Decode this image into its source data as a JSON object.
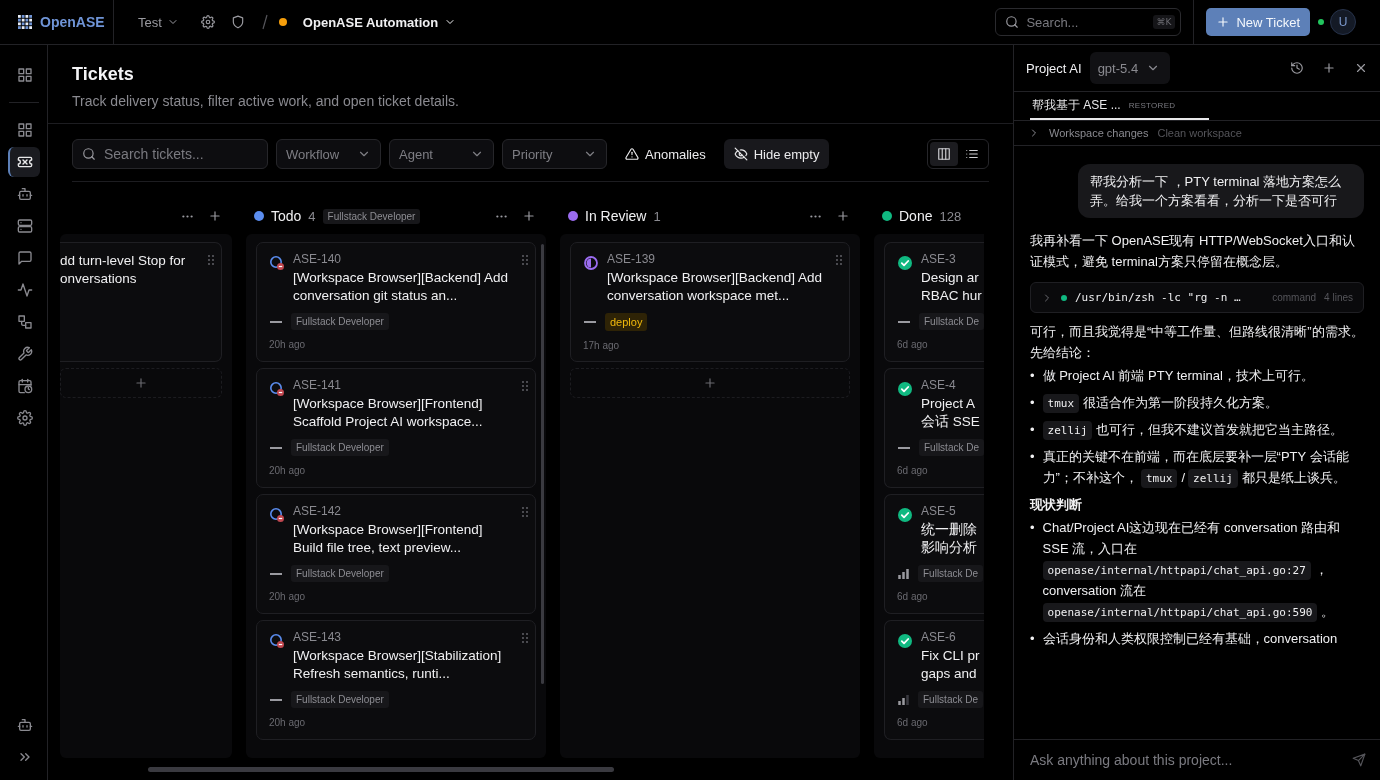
{
  "topbar": {
    "brand": "OpenASE",
    "org": "Test",
    "status_dot": {
      "color": "#f59e0b"
    },
    "project": "OpenASE Automation",
    "search": {
      "placeholder": "Search...",
      "shortcut": "⌘K"
    },
    "new_ticket": "New Ticket",
    "online": true,
    "avatar": "U"
  },
  "sidebar": {
    "home": {
      "kind": "dashboard",
      "selected": false
    },
    "items": [
      {
        "kind": "dashboard",
        "selected": false
      },
      {
        "kind": "ticket",
        "selected": true
      },
      {
        "kind": "bot",
        "selected": false
      },
      {
        "kind": "server",
        "selected": false
      },
      {
        "kind": "chat",
        "selected": false
      },
      {
        "kind": "activity",
        "selected": false
      },
      {
        "kind": "workflow",
        "selected": false
      },
      {
        "kind": "wrench",
        "selected": false
      },
      {
        "kind": "calendar",
        "selected": false
      },
      {
        "kind": "settings",
        "selected": false
      }
    ],
    "bottom": [
      {
        "kind": "bot",
        "selected": false
      },
      {
        "kind": "expand",
        "selected": false
      }
    ]
  },
  "page": {
    "title": "Tickets",
    "subtitle": "Track delivery status, filter active work, and open ticket details."
  },
  "toolbar": {
    "search": {
      "placeholder": "Search tickets..."
    },
    "filters": [
      "Workflow",
      "Agent",
      "Priority"
    ],
    "anomalies": {
      "label": "Anomalies",
      "on": false
    },
    "hide_empty": {
      "label": "Hide empty",
      "on": true
    },
    "views": [
      {
        "kind": "board",
        "selected": true
      },
      {
        "kind": "list",
        "selected": false
      }
    ]
  },
  "board": {
    "columns": [
      {
        "actions": true,
        "add_row": true,
        "cards": [
          {
            "title_lines": [
              "dd turn-level Stop for",
              "onversations"
            ]
          }
        ]
      },
      {
        "name": "Todo",
        "color": "#5b8def",
        "count": "4",
        "tag": "Fullstack Developer",
        "actions": true,
        "add_row": false,
        "cards": [
          {
            "id": "ASE-140",
            "status_icon": {
              "kind": "todo"
            },
            "title_lines": [
              "[Workspace Browser][Backend] Add",
              "conversation git status an..."
            ],
            "priority_icon": {
              "kind": "none"
            },
            "tag": {
              "label": "Fullstack Developer",
              "kind": "agent"
            },
            "time": "20h ago"
          },
          {
            "id": "ASE-141",
            "status_icon": {
              "kind": "todo"
            },
            "title_lines": [
              "[Workspace Browser][Frontend]",
              "Scaffold Project AI workspace..."
            ],
            "priority_icon": {
              "kind": "none"
            },
            "tag": {
              "label": "Fullstack Developer",
              "kind": "agent"
            },
            "time": "20h ago"
          },
          {
            "id": "ASE-142",
            "status_icon": {
              "kind": "todo"
            },
            "title_lines": [
              "[Workspace Browser][Frontend]",
              "Build file tree, text preview..."
            ],
            "priority_icon": {
              "kind": "none"
            },
            "tag": {
              "label": "Fullstack Developer",
              "kind": "agent"
            },
            "time": "20h ago"
          },
          {
            "id": "ASE-143",
            "status_icon": {
              "kind": "todo"
            },
            "title_lines": [
              "[Workspace Browser][Stabilization]",
              "Refresh semantics, runti..."
            ],
            "priority_icon": {
              "kind": "none"
            },
            "tag": {
              "label": "Fullstack Developer",
              "kind": "agent"
            },
            "time": "20h ago"
          }
        ]
      },
      {
        "name": "In Review",
        "color": "#9b6cf0",
        "count": "1",
        "actions": true,
        "add_row": true,
        "cards": [
          {
            "id": "ASE-139",
            "status_icon": {
              "kind": "review"
            },
            "title_lines": [
              "[Workspace Browser][Backend] Add",
              "conversation workspace met..."
            ],
            "priority_icon": {
              "kind": "none"
            },
            "tag": {
              "label": "deploy",
              "kind": "label"
            },
            "time": "17h ago"
          }
        ]
      },
      {
        "name": "Done",
        "color": "#10b981",
        "count": "128",
        "actions": false,
        "add_row": false,
        "cards": [
          {
            "id": "ASE-3",
            "status_icon": {
              "kind": "done"
            },
            "title_lines": [
              "Design ar",
              "RBAC hur"
            ],
            "priority_icon": {
              "kind": "none"
            },
            "tag": {
              "label": "Fullstack De",
              "kind": "agent"
            },
            "time": "6d ago"
          },
          {
            "id": "ASE-4",
            "status_icon": {
              "kind": "done"
            },
            "title_lines": [
              "Project A",
              "会话 SSE"
            ],
            "priority_icon": {
              "kind": "none"
            },
            "tag": {
              "label": "Fullstack De",
              "kind": "agent"
            },
            "time": "6d ago"
          },
          {
            "id": "ASE-5",
            "status_icon": {
              "kind": "done"
            },
            "title_lines": [
              "统一删除",
              "影响分析"
            ],
            "priority_icon": {
              "kind": "high"
            },
            "tag": {
              "label": "Fullstack De",
              "kind": "agent"
            },
            "time": "6d ago"
          },
          {
            "id": "ASE-6",
            "status_icon": {
              "kind": "done"
            },
            "title_lines": [
              "Fix CLI pr",
              "gaps and"
            ],
            "priority_icon": {
              "kind": "low"
            },
            "tag": {
              "label": "Fullstack De",
              "kind": "agent"
            },
            "time": "6d ago"
          }
        ]
      }
    ]
  },
  "assistant": {
    "title": "Project AI",
    "model": "gpt-5.4",
    "tabs": [
      {
        "label": "帮我基于 ASE ...",
        "badge": "RESTORED",
        "selected": true
      }
    ],
    "workspace": {
      "label": "Workspace changes",
      "status": "Clean workspace"
    },
    "messages": [
      {
        "kind": "user",
        "text": "帮我分析一下 ，PTY terminal 落地方案怎么弄。给我一个方案看看，分析一下是否可行"
      },
      {
        "kind": "assistant",
        "blocks": [
          {
            "kind": "paragraph",
            "text": "我再补看一下 OpenASE现有 HTTP/WebSocket入口和认证模式，避免 terminal方案只停留在概念层。"
          },
          {
            "kind": "command",
            "dot": {
              "color": "#10b981"
            },
            "text": "/usr/bin/zsh -lc \"rg -n …",
            "label": "command",
            "meta": "4 lines"
          },
          {
            "kind": "paragraph",
            "text": "可行，而且我觉得是“中等工作量、但路线很清晰”的需求。"
          },
          {
            "kind": "paragraph",
            "text": "先给结论："
          },
          {
            "kind": "bullets",
            "items": [
              {
                "marker": "•",
                "segments": [
                  {
                    "kind": "text",
                    "text": "做 Project AI 前端 PTY terminal，技术上可行。"
                  }
                ]
              },
              {
                "marker": "•",
                "segments": [
                  {
                    "kind": "code",
                    "text": "tmux"
                  },
                  {
                    "kind": "text",
                    "text": "很适合作为第一阶段持久化方案。"
                  }
                ]
              },
              {
                "marker": "•",
                "segments": [
                  {
                    "kind": "code",
                    "text": "zellij"
                  },
                  {
                    "kind": "text",
                    "text": "也可行，但我不建议首发就把它当主路径。"
                  }
                ]
              },
              {
                "marker": "•",
                "segments": [
                  {
                    "kind": "text",
                    "text": "真正的关键不在前端，而在底层要补一层“PTY 会话能力”；不补这个，"
                  },
                  {
                    "kind": "code",
                    "text": "tmux"
                  },
                  {
                    "kind": "text",
                    "text": "/"
                  },
                  {
                    "kind": "code",
                    "text": "zellij"
                  },
                  {
                    "kind": "text",
                    "text": "都只是纸上谈兵。"
                  }
                ]
              }
            ]
          },
          {
            "kind": "heading",
            "text": "现状判断"
          },
          {
            "kind": "bullets",
            "items": [
              {
                "marker": "•",
                "segments": [
                  {
                    "kind": "text",
                    "text": "Chat/Project AI这边现在已经有 conversation 路由和 SSE 流，入口在"
                  },
                  {
                    "kind": "code",
                    "text": "openase/internal/httpapi/chat_api.go:27"
                  },
                  {
                    "kind": "text",
                    "text": "，conversation 流在"
                  },
                  {
                    "kind": "code",
                    "text": "openase/internal/httpapi/chat_api.go:590"
                  },
                  {
                    "kind": "text",
                    "text": "。"
                  }
                ]
              },
              {
                "marker": "•",
                "segments": [
                  {
                    "kind": "text",
                    "text": "会话身份和人类权限控制已经有基础，conversation"
                  }
                ]
              }
            ]
          }
        ]
      }
    ],
    "input": {
      "placeholder": "Ask anything about this project..."
    }
  }
}
